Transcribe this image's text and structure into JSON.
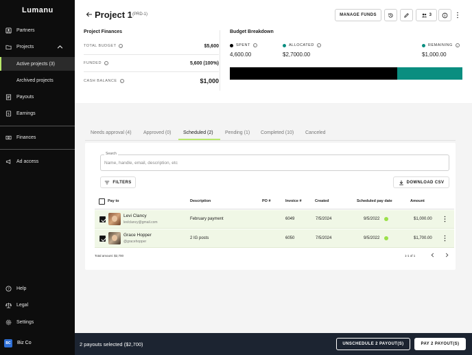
{
  "app": {
    "name": "Lumanu"
  },
  "sidebar": {
    "items": [
      {
        "label": "Partners",
        "icon": "partners-icon"
      },
      {
        "label": "Projects",
        "icon": "folder-icon"
      },
      {
        "label": "Active projects (3)",
        "icon": ""
      },
      {
        "label": "Archived projects",
        "icon": ""
      },
      {
        "label": "Payouts",
        "icon": "payouts-icon"
      },
      {
        "label": "Earnings",
        "icon": "earnings-icon"
      },
      {
        "label": "Finances",
        "icon": "finances-icon"
      },
      {
        "label": "Ad access",
        "icon": "megaphone-icon"
      },
      {
        "label": "Help",
        "icon": "help-icon"
      },
      {
        "label": "Legal",
        "icon": "legal-icon"
      },
      {
        "label": "Settings",
        "icon": "settings-icon"
      }
    ],
    "org": {
      "initials": "BC",
      "name": "Biz Co"
    }
  },
  "header": {
    "title": "Project 1",
    "code": "(PRD-1)",
    "manage_funds": "MANAGE FUNDS",
    "members_count": "3"
  },
  "project_finances": {
    "heading": "Project Finances",
    "rows": [
      {
        "label": "TOTAL BUDGET",
        "value": "$5,600"
      },
      {
        "label": "FUNDED",
        "value": "5,600 (100%)"
      },
      {
        "label": "CASH BALANCE",
        "value": "$1,000"
      }
    ]
  },
  "budget_breakdown": {
    "heading": "Budget Breakdown",
    "spent": {
      "label": "SPENT",
      "value": "4,600.00",
      "color": "#000000"
    },
    "allocated": {
      "label": "ALLOCATED",
      "value": "$2,7000.00",
      "color": "#0a8e80"
    },
    "remaining": {
      "label": "REMAINING",
      "value": "$1,000.00",
      "color": "#0a8e80"
    },
    "spent_fraction": 0.72
  },
  "tabs": [
    {
      "label": "Needs approval (4)"
    },
    {
      "label": "Approved (0)"
    },
    {
      "label": "Scheduled (2)"
    },
    {
      "label": "Pending (1)"
    },
    {
      "label": "Completed (10)"
    },
    {
      "label": "Canceled"
    }
  ],
  "search": {
    "label": "Search",
    "placeholder": "Name, handle, email, description, etc"
  },
  "toolbar": {
    "filters": "FILTERS",
    "download_csv": "DOWNLOAD CSV"
  },
  "table": {
    "columns": [
      "Pay to",
      "Description",
      "PO #",
      "Invoice #",
      "Created",
      "Scheduled pay date",
      "Amount"
    ],
    "rows": [
      {
        "name": "Levi Clancy",
        "handle": "levlclancy@gmail.com",
        "description": "February payment",
        "po": "",
        "invoice": "6049",
        "created": "7/5/2024",
        "scheduled": "9/5/2022",
        "amount": "$1,000.00",
        "checked": true
      },
      {
        "name": "Grace Hopper",
        "handle": "@gracehopper",
        "description": "2 IG posts",
        "po": "",
        "invoice": "6050",
        "created": "7/5/2024",
        "scheduled": "9/5/2022",
        "amount": "$1,700.00",
        "checked": true
      }
    ],
    "total": "Total amount: $2,700",
    "pagination": "1-1 of 1"
  },
  "footer": {
    "selected": "2 payouts selected ($2,700)",
    "unschedule": "UNSCHEDULE 2 PAYOUT(S)",
    "pay": "PAY 2 PAYOUT(S)"
  },
  "colors": {
    "accent": "#b8e86a",
    "teal": "#0a8e80",
    "selected_row": "#f0f7e6",
    "footer_bg": "#1c2431"
  }
}
